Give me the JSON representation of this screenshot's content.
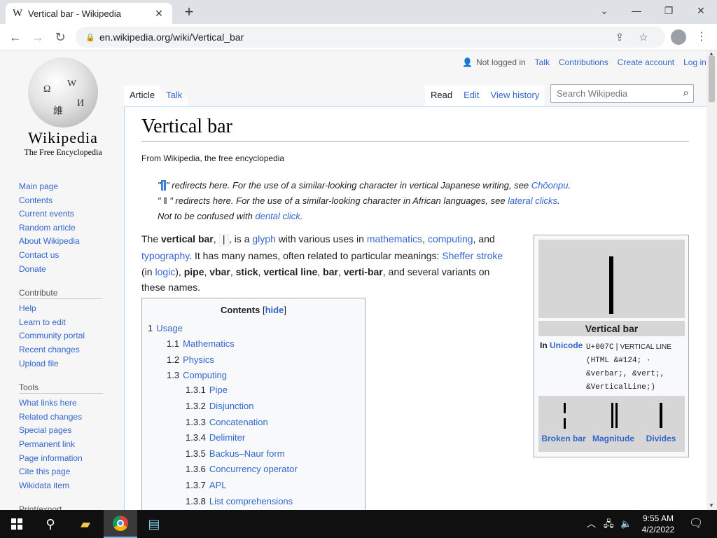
{
  "browser": {
    "tab_title": "Vertical bar - Wikipedia",
    "tab_favicon": "W",
    "new_tab": "+",
    "url": "en.wikipedia.org/wiki/Vertical_bar"
  },
  "sidebar": {
    "wordmark": "Wikipedia",
    "tagline": "The Free Encyclopedia",
    "nav": [
      "Main page",
      "Contents",
      "Current events",
      "Random article",
      "About Wikipedia",
      "Contact us",
      "Donate"
    ],
    "contribute_heading": "Contribute",
    "contribute": [
      "Help",
      "Learn to edit",
      "Community portal",
      "Recent changes",
      "Upload file"
    ],
    "tools_heading": "Tools",
    "tools": [
      "What links here",
      "Related changes",
      "Special pages",
      "Permanent link",
      "Page information",
      "Cite this page",
      "Wikidata item"
    ],
    "print_heading": "Print/export"
  },
  "personal": {
    "not_logged_in": "Not logged in",
    "talk": "Talk",
    "contributions": "Contributions",
    "create_account": "Create account",
    "log_in": "Log in"
  },
  "tabs": {
    "article": "Article",
    "talk": "Talk",
    "read": "Read",
    "edit": "Edit",
    "view_history": "View history"
  },
  "search": {
    "placeholder": "Search Wikipedia"
  },
  "article": {
    "title": "Vertical bar",
    "from": "From Wikipedia, the free encyclopedia",
    "hatnotes": {
      "h1_open": "\"",
      "h1_bar": "|",
      "h1_text": "\" redirects here. For the use of a similar-looking character in vertical Japanese writing, see ",
      "h1_link": "Chōonpu",
      "h1_end": ".",
      "h2_text": "\" ǁ \" redirects here. For the use of a similar-looking character in African languages, see ",
      "h2_link": "lateral clicks",
      "h2_end": ".",
      "h3_text": "Not to be confused with ",
      "h3_link": "dental click",
      "h3_end": "."
    },
    "lead": {
      "t1": "The ",
      "b1": "vertical bar",
      "t2": ", ",
      "code": "|",
      "t3": ", is a ",
      "l1": "glyph",
      "t4": " with various uses in ",
      "l2": "mathematics",
      "t5": ", ",
      "l3": "computing",
      "t6": ", and ",
      "l4": "typography",
      "t7": ". It has many names, often related to particular meanings: ",
      "l5": "Sheffer stroke",
      "t8": " (in ",
      "l6": "logic",
      "t9": "), ",
      "b2": "pipe",
      "t10": ", ",
      "b3": "vbar",
      "t11": ", ",
      "b4": "stick",
      "t12": ", ",
      "b5": "vertical line",
      "t13": ", ",
      "b6": "bar",
      "t14": ", ",
      "b7": "verti-bar",
      "t15": ", and several variants on these names."
    }
  },
  "toc": {
    "title": "Contents",
    "hide_open": "[",
    "hide": "hide",
    "hide_close": "]",
    "entries": [
      {
        "num": "1",
        "label": "Usage"
      },
      {
        "num": "1.1",
        "label": "Mathematics"
      },
      {
        "num": "1.2",
        "label": "Physics"
      },
      {
        "num": "1.3",
        "label": "Computing"
      },
      {
        "num": "1.3.1",
        "label": "Pipe"
      },
      {
        "num": "1.3.2",
        "label": "Disjunction"
      },
      {
        "num": "1.3.3",
        "label": "Concatenation"
      },
      {
        "num": "1.3.4",
        "label": "Delimiter"
      },
      {
        "num": "1.3.5",
        "label": "Backus–Naur form"
      },
      {
        "num": "1.3.6",
        "label": "Concurrency operator"
      },
      {
        "num": "1.3.7",
        "label": "APL"
      },
      {
        "num": "1.3.8",
        "label": "List comprehensions"
      }
    ]
  },
  "infobox": {
    "title": "Vertical bar",
    "unicode_in": "In ",
    "unicode_link": "Unicode",
    "code_point": "U+007C",
    "sep": " | ",
    "char_name": "VERTICAL LINE",
    "html_line1": "(HTML &#124; ·",
    "html_line2": "&verbar;, &vert;,",
    "html_line3": "&VerticalLine;)",
    "variants": [
      "Broken bar",
      "Magnitude",
      "Divides"
    ]
  },
  "taskbar": {
    "time": "9:55 AM",
    "date": "4/2/2022"
  },
  "colors": {
    "link": "#3366cc",
    "selection": "#3a7bd5",
    "taskbar": "#101010"
  }
}
